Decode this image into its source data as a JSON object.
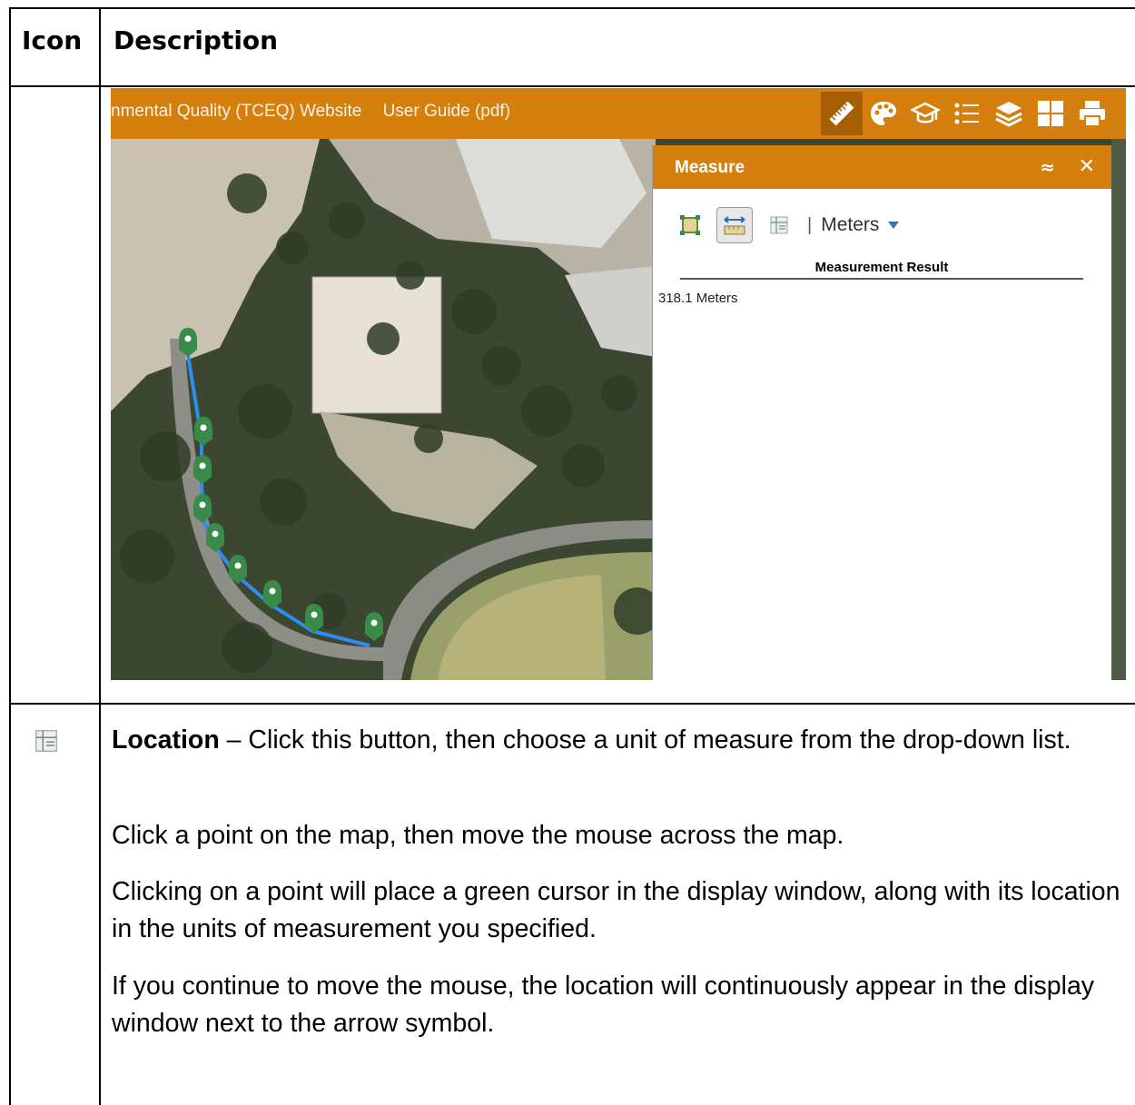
{
  "table": {
    "header_icon": "Icon",
    "header_description": "Description"
  },
  "app": {
    "topbar_links": [
      "nmental Quality (TCEQ) Website",
      "User Guide (pdf)"
    ],
    "tool_icons": [
      "ruler-icon",
      "palette-icon",
      "graduation-cap-icon",
      "legend-list-icon",
      "layers-icon",
      "grid-icon",
      "print-icon"
    ],
    "accent_color": "#d57f0e"
  },
  "measure_panel": {
    "title": "Measure",
    "collapse_glyph": "≈",
    "close_glyph": "✕",
    "separator": "|",
    "unit": "Meters",
    "result_header": "Measurement Result",
    "result_value": "318.1 Meters"
  },
  "description": {
    "p1_bold": "Location",
    "p1_rest": " – Click this button, then choose a unit of measure from the drop-down list.",
    "p2": "Click a point on the map, then move the mouse across the map.",
    "p3": "Clicking on a point will place a green cursor in the display window, along with its location in the units of measurement you specified.",
    "p4": "If you continue to move the mouse, the location will continuously appear in the display window next to the arrow symbol."
  }
}
